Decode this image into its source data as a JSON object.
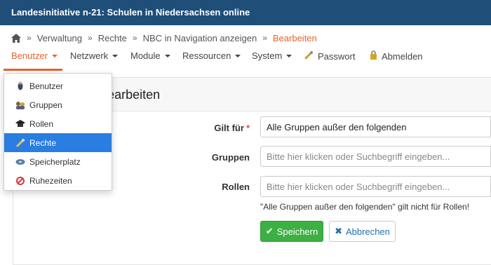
{
  "app": {
    "title": "Landesinitiative n-21: Schulen in Niedersachsen online"
  },
  "breadcrumb": {
    "items": [
      "Verwaltung",
      "Rechte",
      "NBC in Navigation anzeigen"
    ],
    "active": "Bearbeiten",
    "separator": "»"
  },
  "nav": {
    "benutzer": "Benutzer",
    "netzwerk": "Netzwerk",
    "module": "Module",
    "ressourcen": "Ressourcen",
    "system": "System",
    "passwort": "Passwort",
    "abmelden": "Abmelden"
  },
  "dropdown": {
    "items": [
      {
        "label": "Benutzer",
        "icon": "user-icon"
      },
      {
        "label": "Gruppen",
        "icon": "group-icon"
      },
      {
        "label": "Rollen",
        "icon": "graduation-cap-icon"
      },
      {
        "label": "Rechte",
        "icon": "key-icon",
        "selected": true
      },
      {
        "label": "Speicherplatz",
        "icon": "disk-icon"
      },
      {
        "label": "Ruhezeiten",
        "icon": "no-entry-icon"
      }
    ]
  },
  "panel": {
    "title": "NBC in Navigation anzeigen bearbeiten",
    "title_visible": "tion anzeigen bearbeiten"
  },
  "form": {
    "gilt_fuer": {
      "label": "Gilt für",
      "required": "*",
      "value": "Alle Gruppen außer den folgenden"
    },
    "gruppen": {
      "label": "Gruppen",
      "placeholder": "Bitte hier klicken oder Suchbegriff eingeben..."
    },
    "rollen": {
      "label": "Rollen",
      "placeholder": "Bitte hier klicken oder Suchbegriff eingeben...",
      "hint": "\"Alle Gruppen außer den folgenden\" gilt nicht für Rollen!"
    }
  },
  "buttons": {
    "save": "Speichern",
    "cancel": "Abbrechen"
  },
  "colors": {
    "header": "#1f4e79",
    "accent": "#e8622c",
    "save": "#3cb043",
    "selected": "#2a7de1"
  }
}
